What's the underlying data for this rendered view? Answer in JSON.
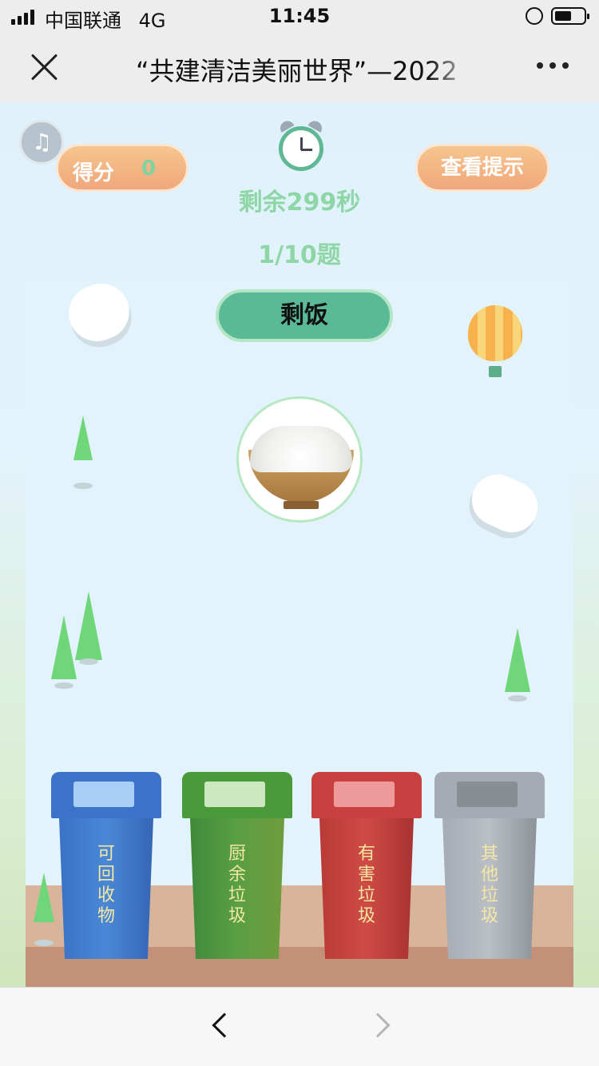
{
  "status_bar": {
    "carrier": "中国联通",
    "network": "4G",
    "time": "11:45"
  },
  "nav": {
    "title": "“共建清洁美丽世界”—2022"
  },
  "game": {
    "score_label": "得分",
    "score_value": "0",
    "hint_label": "查看提示",
    "timer_text": "剩余299秒",
    "progress_text": "1/10题",
    "item_name": "剩饭"
  },
  "bins": [
    {
      "label": "可回收物",
      "color": "#3d72c9"
    },
    {
      "label": "厨余垃圾",
      "color": "#4a9a3c"
    },
    {
      "label": "有害垃圾",
      "color": "#c84040"
    },
    {
      "label": "其他垃圾",
      "color": "#a6aab2"
    }
  ],
  "icons": {
    "close": "close-icon",
    "more": "more-icon",
    "music": "music-icon",
    "alarm": "alarm-clock-icon",
    "back": "back-arrow-icon",
    "forward": "forward-arrow-icon"
  },
  "colors": {
    "accent_green": "#8fd6a6",
    "pill_orange": "#f0a77b",
    "item_pill": "#5ab996"
  }
}
